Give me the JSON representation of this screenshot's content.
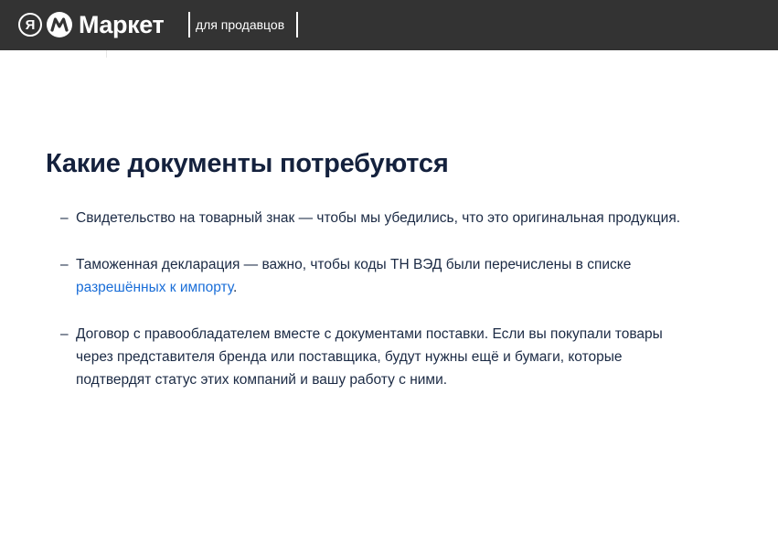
{
  "header": {
    "logo_letter": "Я",
    "brand": "Маркет",
    "subtitle": "для продавцов"
  },
  "content": {
    "title": "Какие документы потребуются",
    "items": [
      {
        "dash": "–",
        "text": "Свидетельство на товарный знак — чтобы мы убедились, что это оригинальная продукция."
      },
      {
        "dash": "–",
        "text_before": "Таможенная декларация — важно, чтобы коды ТН ВЭД были перечислены в списке ",
        "link": "разрешённых к импорту",
        "text_after": "."
      },
      {
        "dash": "–",
        "text": "Договор с правообладателем вместе с документами поставки. Если вы покупали товары через представителя бренда или поставщика, будут нужны ещё и бумаги, которые подтвердят статус этих компаний и вашу работу с ними."
      }
    ]
  },
  "colors": {
    "header_bg": "#333333",
    "text": "#1b2a44",
    "title": "#14213d",
    "link": "#1a6ed8"
  }
}
